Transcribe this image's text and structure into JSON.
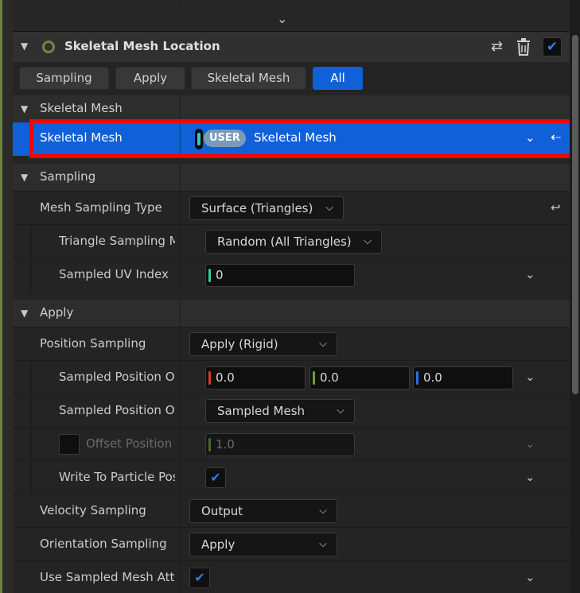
{
  "module": {
    "title": "Skeletal Mesh Location",
    "colors": {
      "accent": "#1060d8",
      "enabled_dot": "#6e8a3a",
      "highlight": "#ff0000"
    }
  },
  "filters": {
    "items": [
      {
        "label": "Sampling"
      },
      {
        "label": "Apply"
      },
      {
        "label": "Skeletal Mesh"
      },
      {
        "label": "All"
      }
    ],
    "active": "All"
  },
  "sections": {
    "skeletal_mesh": {
      "title": "Skeletal Mesh",
      "prop_label": "Skeletal Mesh",
      "badge": "USER",
      "value": "Skeletal Mesh"
    },
    "sampling": {
      "title": "Sampling",
      "mesh_sampling_type": {
        "label": "Mesh Sampling Type",
        "value": "Surface (Triangles)"
      },
      "triangle_sampling_mode": {
        "label": "Triangle Sampling Mode",
        "value": "Random (All Triangles)"
      },
      "sampled_uv_index": {
        "label": "Sampled UV Index",
        "value": "0"
      }
    },
    "apply": {
      "title": "Apply",
      "position_sampling": {
        "label": "Position Sampling",
        "value": "Apply (Rigid)"
      },
      "sampled_position_offset": {
        "label": "Sampled Position Offset",
        "x": "0.0",
        "y": "0.0",
        "z": "0.0"
      },
      "sampled_position_offset_space": {
        "label": "Sampled Position Offset Space",
        "value": "Sampled Mesh"
      },
      "offset_position": {
        "label": "Offset Position Along Normal",
        "value": "1.0"
      },
      "write_to_particle_position": {
        "label": "Write To Particle Position",
        "checked": true
      },
      "velocity_sampling": {
        "label": "Velocity Sampling",
        "value": "Output"
      },
      "orientation_sampling": {
        "label": "Orientation Sampling",
        "value": "Apply"
      },
      "use_sampled_mesh_attributes": {
        "label": "Use Sampled Mesh Attributes",
        "checked": true
      }
    }
  }
}
